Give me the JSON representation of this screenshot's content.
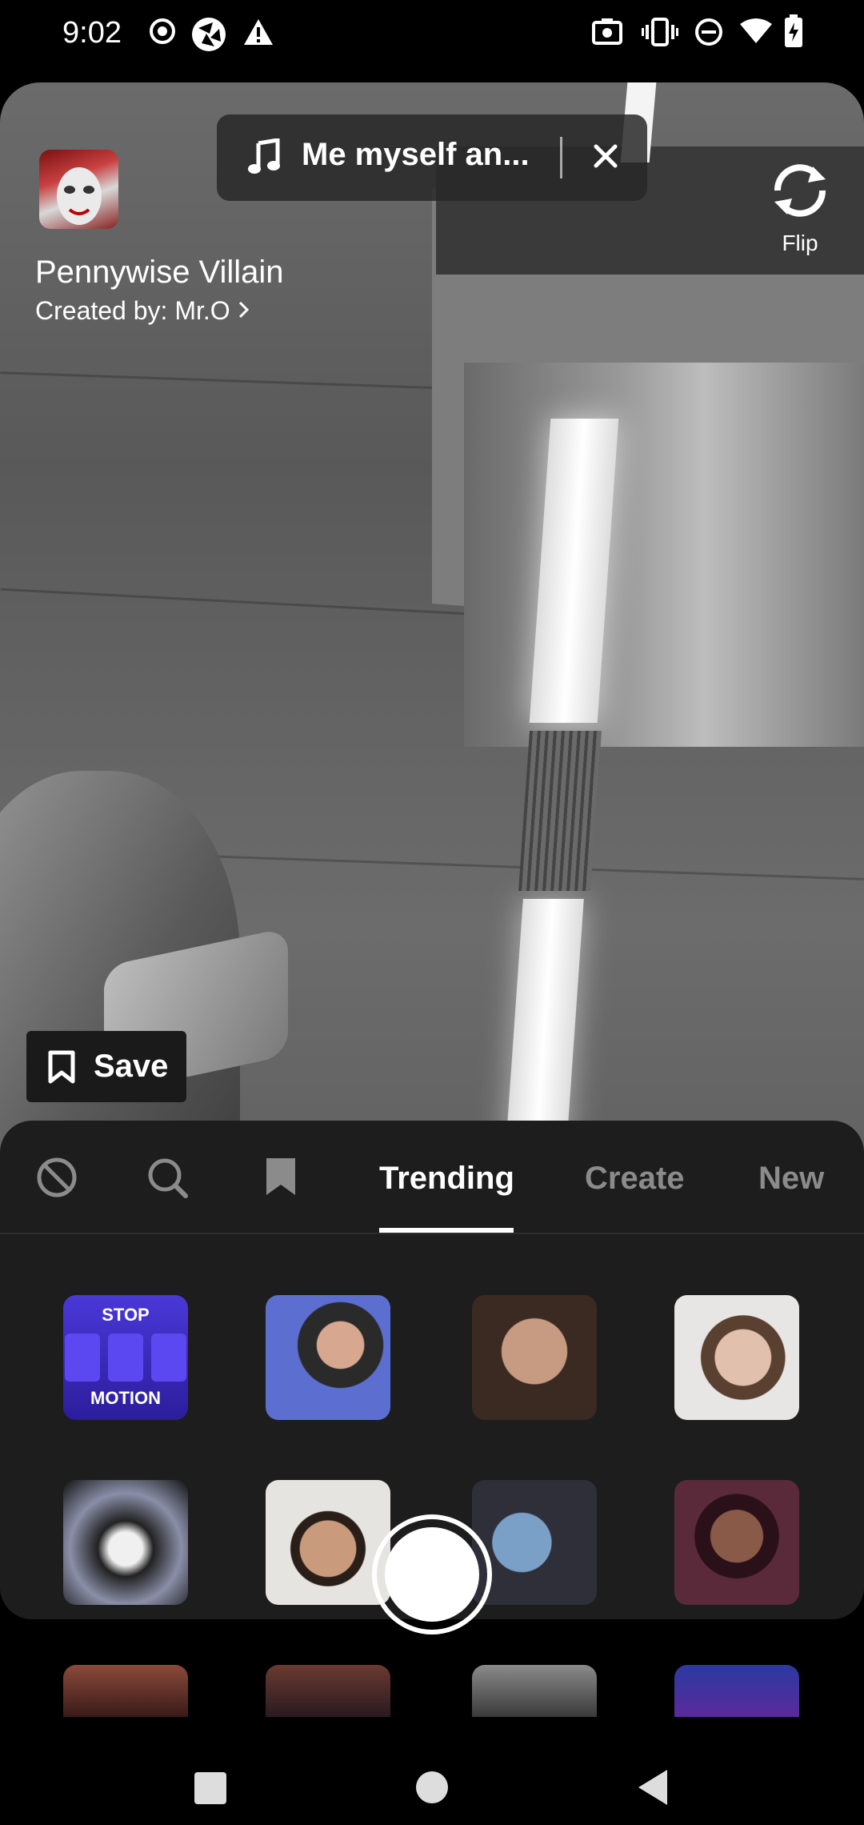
{
  "status_bar": {
    "time": "9:02",
    "left_icons": [
      "record-dot-icon",
      "shutter-icon",
      "warning-icon"
    ],
    "right_icons": [
      "screenshot-icon",
      "vibrate-icon",
      "do-not-disturb-icon",
      "wifi-icon",
      "battery-charging-icon"
    ]
  },
  "music": {
    "song": "Me myself an...",
    "icon": "music-note-icon"
  },
  "effect": {
    "title": "Pennywise Villain",
    "creator": "Created by: Mr.O"
  },
  "flip": {
    "label": "Flip"
  },
  "save": {
    "label": "Save"
  },
  "tabs": [
    {
      "label": "Trending",
      "active": true
    },
    {
      "label": "Create",
      "active": false
    },
    {
      "label": "New",
      "active": false
    }
  ],
  "stop_motion": {
    "top": "STOP",
    "bottom": "MOTION"
  },
  "colors": {
    "panel": "#1d1d1d",
    "accent": "#ffffff",
    "inactive_tab": "#8b8b8b",
    "stop_motion_bg": "#3a2ac8"
  }
}
